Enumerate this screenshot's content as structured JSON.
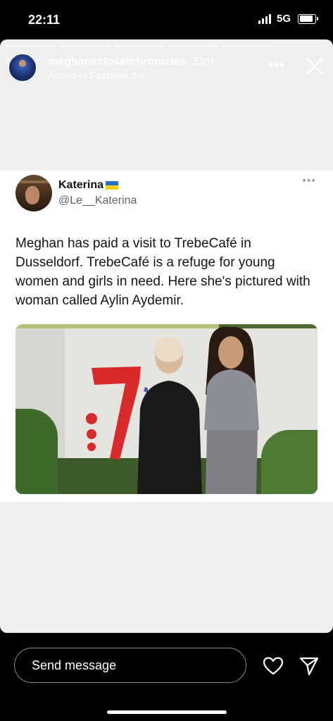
{
  "status_bar": {
    "time": "22:11",
    "network": "5G"
  },
  "story": {
    "username": "meghansclosetchronicles",
    "time_ago": "33m",
    "added_prefix": "Added to ",
    "collection": "Fashion 3",
    "chevron": ">",
    "more": "•••"
  },
  "tweet": {
    "name": "Katerina",
    "handle": "@Le__Katerina",
    "more": "•••",
    "text": "Meghan has paid a visit to TrebeCafé in Dusseldorf. TrebeCafé is a refuge for young women and girls in need. Here she's pictured with woman called Aylin Aydemir."
  },
  "footer": {
    "send_placeholder": "Send message"
  },
  "icons": {
    "close": "close-icon",
    "heart": "heart-icon",
    "share": "send-icon",
    "signal": "signal-icon",
    "battery": "battery-icon",
    "flag": "ukraine-flag-icon"
  },
  "colors": {
    "story_bg": "#efefef",
    "flag_blue": "#1f6fd1",
    "flag_yellow": "#f5d000",
    "handle": "#536471",
    "graffiti": "#d8292b"
  }
}
